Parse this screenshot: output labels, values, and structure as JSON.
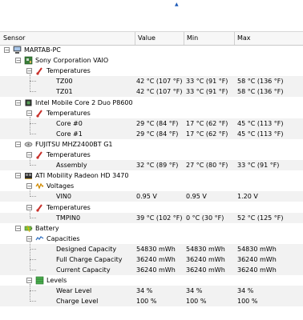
{
  "columns": [
    "Sensor",
    "Value",
    "Min",
    "Max"
  ],
  "rows": [
    {
      "label": "MARTAB-PC",
      "level": 0,
      "icon": "computer-icon",
      "expander": "−"
    },
    {
      "label": "Sony Corporation VAIO",
      "level": 1,
      "icon": "motherboard-icon",
      "expander": "−"
    },
    {
      "label": "Temperatures",
      "level": 2,
      "icon": "thermometer-icon",
      "expander": "−"
    },
    {
      "label": "TZ00",
      "level": 3,
      "value": "42 °C  (107 °F)",
      "min": "33 °C  (91 °F)",
      "max": "58 °C  (136 °F)"
    },
    {
      "label": "TZ01",
      "level": 3,
      "value": "42 °C  (107 °F)",
      "min": "33 °C  (91 °F)",
      "max": "58 °C  (136 °F)"
    },
    {
      "label": "Intel Mobile Core 2 Duo P8600",
      "level": 1,
      "icon": "cpu-icon",
      "expander": "−"
    },
    {
      "label": "Temperatures",
      "level": 2,
      "icon": "thermometer-icon",
      "expander": "−"
    },
    {
      "label": "Core #0",
      "level": 3,
      "value": "29 °C  (84 °F)",
      "min": "17 °C  (62 °F)",
      "max": "45 °C  (113 °F)"
    },
    {
      "label": "Core #1",
      "level": 3,
      "value": "29 °C  (84 °F)",
      "min": "17 °C  (62 °F)",
      "max": "45 °C  (113 °F)"
    },
    {
      "label": "FUJITSU MHZ2400BT G1",
      "level": 1,
      "icon": "hard-disk-icon",
      "expander": "−"
    },
    {
      "label": "Temperatures",
      "level": 2,
      "icon": "thermometer-icon",
      "expander": "−"
    },
    {
      "label": "Assembly",
      "level": 3,
      "value": "32 °C  (89 °F)",
      "min": "27 °C  (80 °F)",
      "max": "33 °C  (91 °F)"
    },
    {
      "label": "ATI Mobility Radeon HD 3470",
      "level": 1,
      "icon": "gpu-icon",
      "expander": "−"
    },
    {
      "label": "Voltages",
      "level": 2,
      "icon": "voltage-icon",
      "expander": "−"
    },
    {
      "label": "VIN0",
      "level": 3,
      "value": "0.95 V",
      "min": "0.95 V",
      "max": "1.20 V"
    },
    {
      "label": "Temperatures",
      "level": 2,
      "icon": "thermometer-icon",
      "expander": "−"
    },
    {
      "label": "TMPIN0",
      "level": 3,
      "value": "39 °C  (102 °F)",
      "min": "0 °C  (30 °F)",
      "max": "52 °C  (125 °F)"
    },
    {
      "label": "Battery",
      "level": 1,
      "icon": "battery-icon",
      "expander": "−"
    },
    {
      "label": "Capacities",
      "level": 2,
      "icon": "capacity-icon",
      "expander": "−"
    },
    {
      "label": "Designed Capacity",
      "level": 3,
      "value": "54830 mWh",
      "min": "54830 mWh",
      "max": "54830 mWh"
    },
    {
      "label": "Full Charge Capacity",
      "level": 3,
      "value": "36240 mWh",
      "min": "36240 mWh",
      "max": "36240 mWh"
    },
    {
      "label": "Current Capacity",
      "level": 3,
      "value": "36240 mWh",
      "min": "36240 mWh",
      "max": "36240 mWh"
    },
    {
      "label": "Levels",
      "level": 2,
      "icon": "level-icon",
      "expander": "−"
    },
    {
      "label": "Wear Level",
      "level": 3,
      "value": "34 %",
      "min": "34 %",
      "max": "34 %"
    },
    {
      "label": "Charge Level",
      "level": 3,
      "value": "100 %",
      "min": "100 %",
      "max": "100 %"
    }
  ]
}
